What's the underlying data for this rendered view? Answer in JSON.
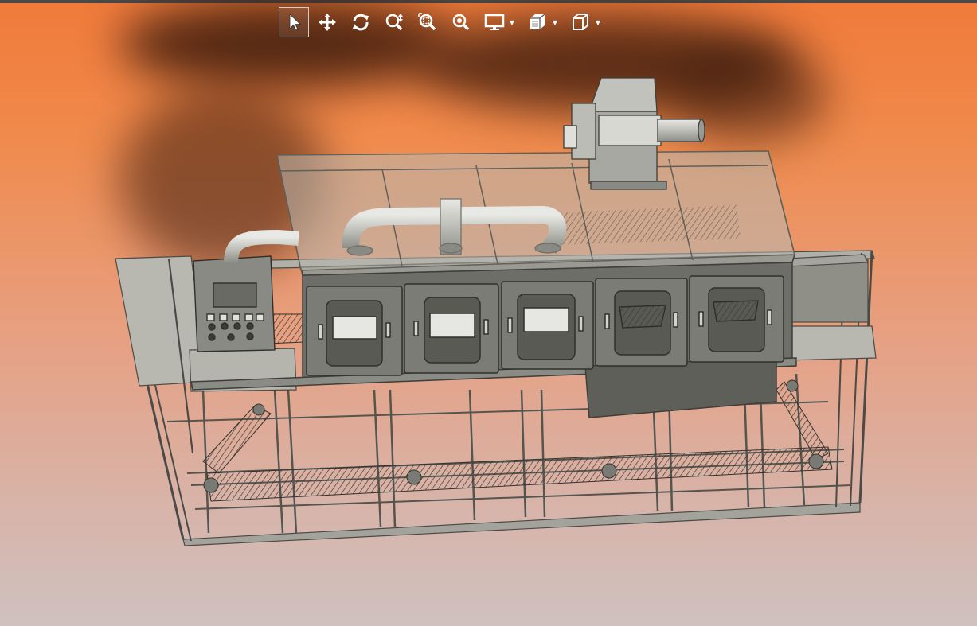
{
  "toolbar": {
    "buttons": [
      {
        "id": "select",
        "icon": "cursor-arrow-icon",
        "active": true
      },
      {
        "id": "pan",
        "icon": "move-arrows-icon",
        "active": false
      },
      {
        "id": "rotate",
        "icon": "rotate-icon",
        "active": false
      },
      {
        "id": "zoom",
        "icon": "zoom-updown-icon",
        "active": false
      },
      {
        "id": "zoom-window",
        "icon": "zoom-window-icon",
        "active": false
      },
      {
        "id": "zoom-fit",
        "icon": "zoom-fit-icon",
        "active": false
      },
      {
        "id": "display",
        "icon": "monitor-icon",
        "active": false,
        "dropdown": true
      },
      {
        "id": "section",
        "icon": "section-view-icon",
        "active": false,
        "dropdown": true
      },
      {
        "id": "view",
        "icon": "cube-view-icon",
        "active": false,
        "dropdown": true
      }
    ]
  },
  "colors": {
    "bg_top": "#f07a3a",
    "bg_bottom": "#cfc1bf",
    "icon_color": "#ffffff",
    "frame_color": "#8a8a84",
    "panel_color": "#6e6e68",
    "pipe_color": "#c9c9c4"
  }
}
